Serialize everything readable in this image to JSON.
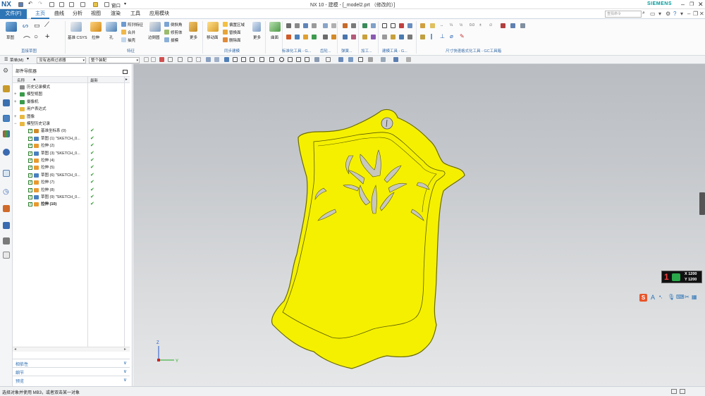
{
  "titlebar": {
    "logo": "NX",
    "window_menu": "窗口",
    "title": "NX 10 - 建模 - [_model2.prt （修改的）]",
    "brand": "SIEMENS"
  },
  "tabs": {
    "file": "文件(F)",
    "items": [
      "主页",
      "曲线",
      "分析",
      "视图",
      "渲染",
      "工具",
      "应用模块"
    ],
    "active": "主页",
    "search_placeholder": "查找命令"
  },
  "ribbon": {
    "sketch": "草图",
    "datum_csys": "基准 CSYS",
    "extrude": "拉伸",
    "hole": "孔",
    "array_feature": "阵列特征",
    "unite": "合并",
    "shell": "抽壳",
    "edge_blend": "边倒圆",
    "chamfer": "倒斜角",
    "trim_body": "修剪体",
    "draft": "拔模",
    "more": "更多",
    "move_face": "移动面",
    "offset_region": "偏置区域",
    "replace_face": "替换面",
    "delete_face": "删除面",
    "more2": "更多",
    "surface": "曲面",
    "groups": {
      "direct_sketch": "直接草图",
      "feature": "特征",
      "sync_modeling": "同步建模",
      "standardize": "标准化工具 - G...",
      "gear": "齿轮...",
      "spring": "弹簧...",
      "machining": "加工...",
      "modeling_tools": "建模工具 - G...",
      "dimension_tools": "尺寸快速格式化工具 - GC工具箱"
    }
  },
  "selbar": {
    "menu": "菜单(M)",
    "filter": "没有选择过滤器",
    "assembly": "整个装配"
  },
  "navigator": {
    "title": "部件导航器",
    "col_name": "名称",
    "col_latest": "最新",
    "rows": [
      {
        "label": "历史记录模式",
        "indent": 0,
        "type": "history"
      },
      {
        "label": "模型视图",
        "indent": 0,
        "type": "view",
        "exp": "+"
      },
      {
        "label": "摄像机",
        "indent": 0,
        "type": "camera",
        "exp": "+"
      },
      {
        "label": "用户表达式",
        "indent": 0,
        "type": "folder"
      },
      {
        "label": "图像",
        "indent": 0,
        "type": "folder",
        "exp": "+"
      },
      {
        "label": "模型历史记录",
        "indent": 0,
        "type": "folder",
        "exp": "−"
      },
      {
        "label": "基准坐标系 (0)",
        "indent": 1,
        "type": "csys",
        "ok": "✔"
      },
      {
        "label": "草图 (1) \"SKETCH_0...",
        "indent": 1,
        "type": "sketch",
        "ok": "✔"
      },
      {
        "label": "拉伸 (2)",
        "indent": 1,
        "type": "extrude",
        "ok": "✔"
      },
      {
        "label": "草图 (3) \"SKETCH_0...",
        "indent": 1,
        "type": "sketch",
        "ok": "✔"
      },
      {
        "label": "拉伸 (4)",
        "indent": 1,
        "type": "extrude",
        "ok": "✔"
      },
      {
        "label": "拉伸 (5)",
        "indent": 1,
        "type": "extrude",
        "ok": "✔"
      },
      {
        "label": "草图 (6) \"SKETCH_0...",
        "indent": 1,
        "type": "sketch",
        "ok": "✔"
      },
      {
        "label": "拉伸 (7)",
        "indent": 1,
        "type": "extrude",
        "ok": "✔"
      },
      {
        "label": "拉伸 (8)",
        "indent": 1,
        "type": "extrude",
        "ok": "✔"
      },
      {
        "label": "草图 (9) \"SKETCH_0...",
        "indent": 1,
        "type": "sketch",
        "ok": "✔"
      },
      {
        "label": "拉伸 (10)",
        "indent": 1,
        "type": "extrude",
        "ok": "✔",
        "bold": true
      }
    ],
    "panels": [
      "相依性",
      "细节",
      "预览"
    ]
  },
  "graphics": {
    "coord_num": "1",
    "coord_x": "X 1200",
    "coord_y": "Y 1200",
    "axis_z": "Z",
    "axis_y": "Y",
    "colors": {
      "part": "#f5f000",
      "part_stroke": "#6b6b00"
    }
  },
  "status": {
    "text": "选择对象并使用 MB3，或者双击某一对象"
  }
}
